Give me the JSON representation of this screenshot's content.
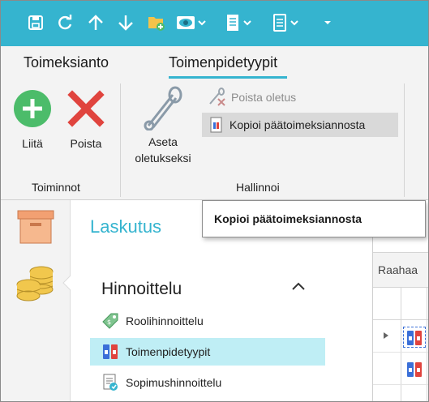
{
  "quick_access": {
    "buttons": [
      "save-icon",
      "refresh-icon",
      "arrow-up-icon",
      "arrow-down-icon",
      "new-folder-icon",
      "view-icon",
      "document-icon",
      "form-icon",
      "customize-icon"
    ]
  },
  "tabs": [
    {
      "label": "Toimeksianto",
      "active": false
    },
    {
      "label": "Toimenpidetyypit",
      "active": true
    }
  ],
  "ribbon": {
    "groups": [
      {
        "label": "Toiminnot",
        "buttons": [
          {
            "label": "Liitä",
            "icon": "add-icon"
          },
          {
            "label": "Poista",
            "icon": "delete-icon"
          }
        ]
      },
      {
        "label": "Hallinnoi",
        "large_button": {
          "label_line1": "Aseta",
          "label_line2": "oletukseksi",
          "icon": "safety-pin-icon"
        },
        "small_buttons": [
          {
            "label": "Poista oletus",
            "icon": "remove-default-icon",
            "enabled": false
          },
          {
            "label": "Kopioi päätoimeksiannosta",
            "icon": "copy-document-icon",
            "enabled": true
          }
        ]
      }
    ]
  },
  "tooltip": {
    "text": "Kopioi päätoimeksiannosta"
  },
  "navstrip": {
    "icons": [
      "archive-box-icon",
      "coins-icon"
    ]
  },
  "panel": {
    "title": "Laskutus",
    "section": "Hinnoittelu",
    "items": [
      {
        "label": "Roolihinnoittelu",
        "icon": "price-tag-icon",
        "selected": false
      },
      {
        "label": "Toimenpidetyypit",
        "icon": "binders-icon",
        "selected": true
      },
      {
        "label": "Sopimushinnoittelu",
        "icon": "contract-icon",
        "selected": false
      }
    ]
  },
  "grid": {
    "header": "Raahaa"
  },
  "colors": {
    "accent": "#35b4cf",
    "selection": "#bfeef5",
    "delete_red": "#e0443e",
    "add_green": "#4cbc6a"
  }
}
